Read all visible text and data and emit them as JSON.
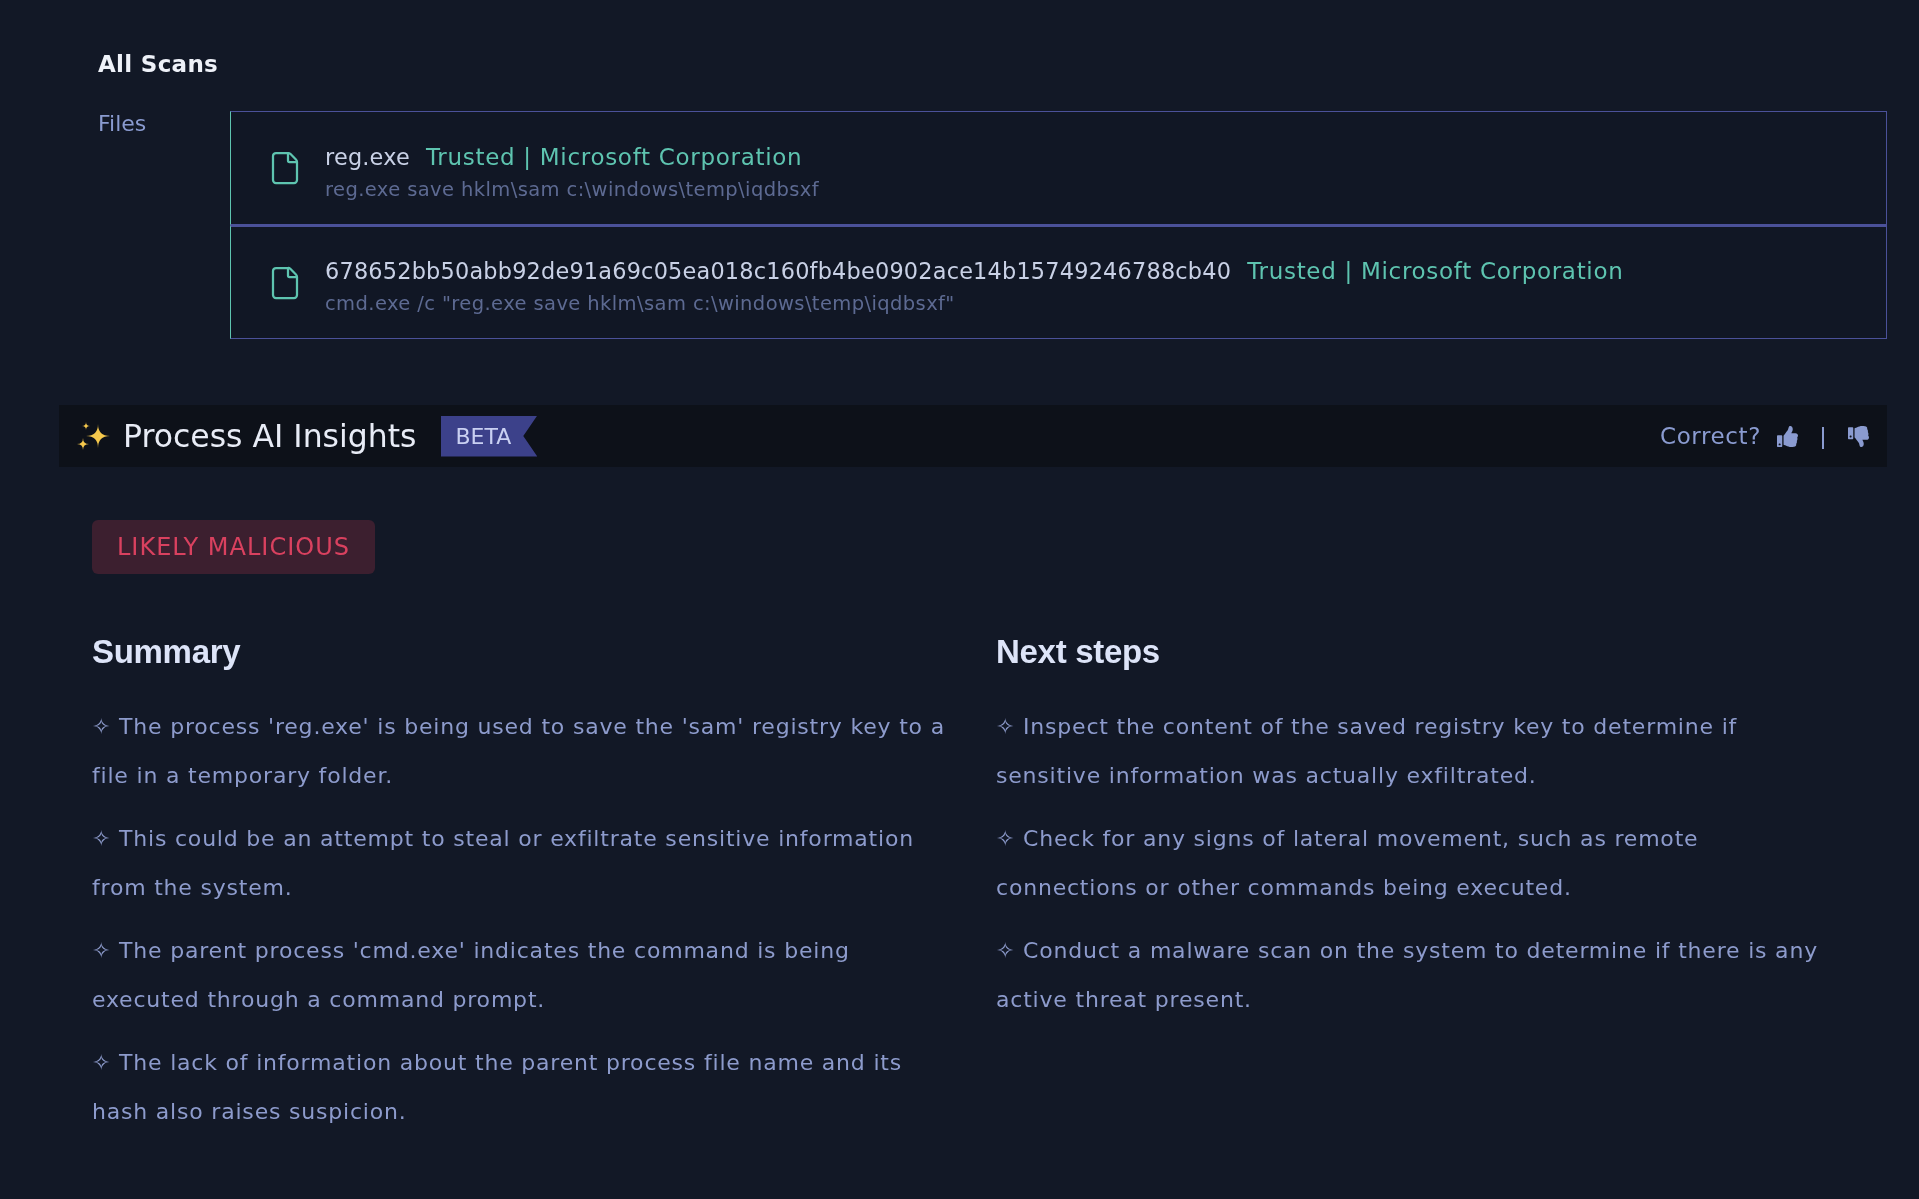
{
  "page": {
    "title": "All Scans"
  },
  "files": {
    "label": "Files",
    "items": [
      {
        "name": "reg.exe",
        "trust": "Trusted | Microsoft Corporation",
        "command": "reg.exe save hklm\\sam c:\\windows\\temp\\iqdbsxf"
      },
      {
        "name": "678652bb50abb92de91a69c05ea018c160fb4be0902ace14b15749246788cb40",
        "trust": "Trusted | Microsoft Corporation",
        "command": "cmd.exe /c \"reg.exe save hklm\\sam c:\\windows\\temp\\iqdbsxf\""
      }
    ]
  },
  "ai_insights": {
    "title": "Process AI Insights",
    "badge": "BETA",
    "feedback": {
      "label": "Correct?"
    },
    "verdict": "LIKELY MALICIOUS",
    "sections": [
      {
        "heading": "Summary",
        "items": [
          "✧ The process 'reg.exe' is being used to save the 'sam' registry key to a file in a temporary folder.",
          "✧ This could be an attempt to steal or exfiltrate sensitive information from the system.",
          "✧ The parent process 'cmd.exe' indicates the command is being executed through a command prompt.",
          "✧ The lack of information about the parent process file name and its hash also raises suspicion."
        ]
      },
      {
        "heading": "Next steps",
        "items": [
          "✧ Inspect the content of the saved registry key to determine if sensitive information was actually exfiltrated.",
          "✧ Check for any signs of lateral movement, such as remote connections or other commands being executed.",
          "✧ Conduct a malware scan on the system to determine if there is any active threat present."
        ]
      }
    ]
  }
}
